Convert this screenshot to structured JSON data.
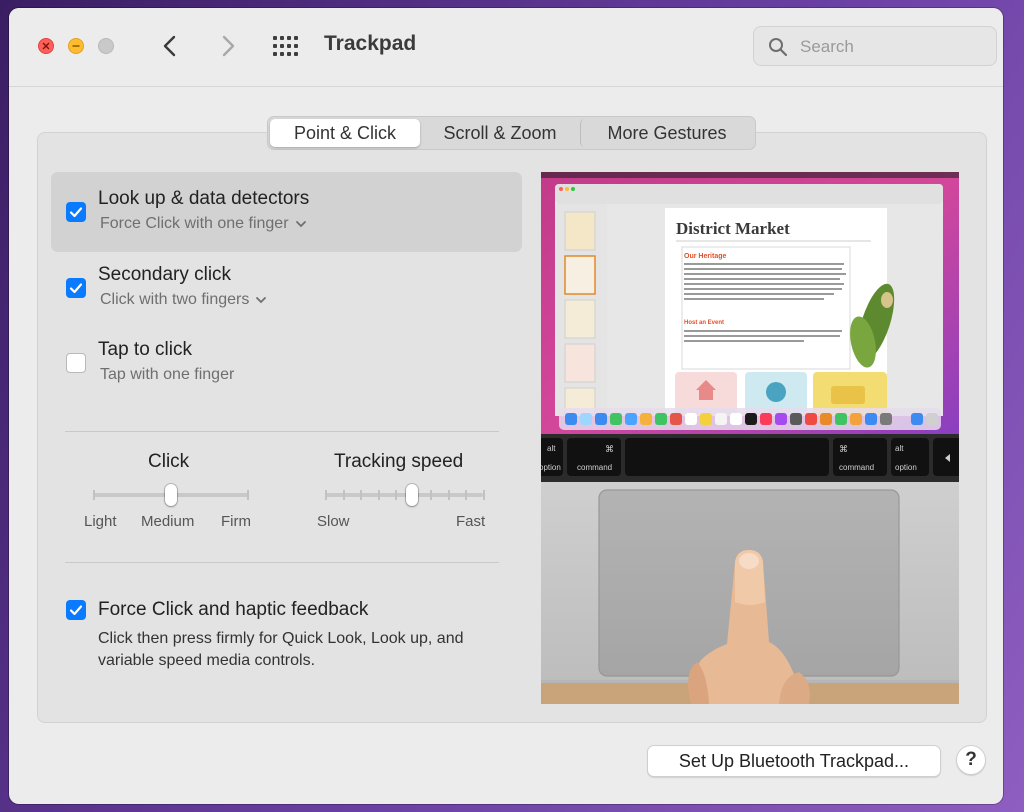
{
  "window": {
    "title": "Trackpad",
    "search_placeholder": "Search"
  },
  "tabs": [
    {
      "label": "Point & Click",
      "selected": true
    },
    {
      "label": "Scroll & Zoom",
      "selected": false
    },
    {
      "label": "More Gestures",
      "selected": false
    }
  ],
  "options": [
    {
      "title": "Look up & data detectors",
      "subtitle": "Force Click with one finger",
      "checked": true,
      "has_menu": true
    },
    {
      "title": "Secondary click",
      "subtitle": "Click with two fingers",
      "checked": true,
      "has_menu": true
    },
    {
      "title": "Tap to click",
      "subtitle": "Tap with one finger",
      "checked": false,
      "has_menu": false
    }
  ],
  "click_slider": {
    "title": "Click",
    "labels": [
      "Light",
      "Medium",
      "Firm"
    ],
    "value": "Medium"
  },
  "tracking_slider": {
    "title": "Tracking speed",
    "min_label": "Slow",
    "max_label": "Fast",
    "ticks": 10,
    "position": 0.55
  },
  "force_click": {
    "title": "Force Click and haptic feedback",
    "checked": true,
    "description": "Click then press firmly for Quick Look, Look up, and variable speed media controls."
  },
  "preview": {
    "doc_title": "District Market",
    "section_1": "Our Heritage",
    "section_2": "Host an Event",
    "key_left_1": "alt",
    "key_left_2": "option",
    "key_left_3": "command",
    "key_right_1": "command",
    "key_right_2": "alt",
    "key_right_3": "option"
  },
  "buttons": {
    "bluetooth": "Set Up Bluetooth Trackpad...",
    "help": "?"
  },
  "colors": {
    "accent": "#0a7afe",
    "close": "#fe5f57",
    "minimize": "#febc2e"
  }
}
